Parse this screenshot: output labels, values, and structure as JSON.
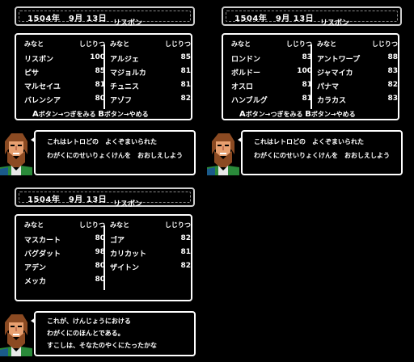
{
  "panels": [
    {
      "date": "1504年　9月 13日",
      "city": "リスボン",
      "headers": {
        "port": "みなと",
        "support": "しじりつ"
      },
      "left": [
        {
          "name": "リスボン",
          "value": "100"
        },
        {
          "name": "ピサ",
          "value": "85"
        },
        {
          "name": "マルセイユ",
          "value": "81"
        },
        {
          "name": "バレンシア",
          "value": "80"
        }
      ],
      "right": [
        {
          "name": "アルジェ",
          "value": "85"
        },
        {
          "name": "マジョルカ",
          "value": "81"
        },
        {
          "name": "チュニス",
          "value": "81"
        },
        {
          "name": "アゾフ",
          "value": "82"
        }
      ],
      "footer": {
        "a_btn": "A",
        "a_text": "ボタン→つぎをみる",
        "b_btn": "B",
        "b_text": "ボタン→やめる"
      },
      "message": [
        "これはレトロどの　よくぞまいられた",
        "わがくにのせいりょくけんを　おおしえしよう"
      ]
    },
    {
      "date": "1504年　9月 13日",
      "city": "リスボン",
      "headers": {
        "port": "みなと",
        "support": "しじりつ"
      },
      "left": [
        {
          "name": "ロンドン",
          "value": "83"
        },
        {
          "name": "ボルドー",
          "value": "100"
        },
        {
          "name": "オスロ",
          "value": "81"
        },
        {
          "name": "ハンブルグ",
          "value": "81"
        }
      ],
      "right": [
        {
          "name": "アントワープ",
          "value": "88"
        },
        {
          "name": "ジャマイカ",
          "value": "83"
        },
        {
          "name": "パナマ",
          "value": "82"
        },
        {
          "name": "カラカス",
          "value": "83"
        }
      ],
      "footer": {
        "a_btn": "A",
        "a_text": "ボタン→つぎをみる",
        "b_btn": "B",
        "b_text": "ボタン→やめる"
      },
      "message": [
        "これはレトロどの　よくぞまいられた",
        "わがくにのせいりょくけんを　おおしえしよう"
      ]
    },
    {
      "date": "1504年　9月 13日",
      "city": "リスボン",
      "headers": {
        "port": "みなと",
        "support": "しじりつ"
      },
      "left": [
        {
          "name": "マスカート",
          "value": "80"
        },
        {
          "name": "バグダット",
          "value": "98"
        },
        {
          "name": "アデン",
          "value": "80"
        },
        {
          "name": "メッカ",
          "value": "80"
        }
      ],
      "right": [
        {
          "name": "ゴア",
          "value": "82"
        },
        {
          "name": "カリカット",
          "value": "81"
        },
        {
          "name": "ザイトン",
          "value": "82"
        }
      ],
      "message": [
        "これが、けんじょうにおける",
        "わがくにのほんとである。",
        "すこしは、そなたのやくにたったかな"
      ]
    }
  ]
}
